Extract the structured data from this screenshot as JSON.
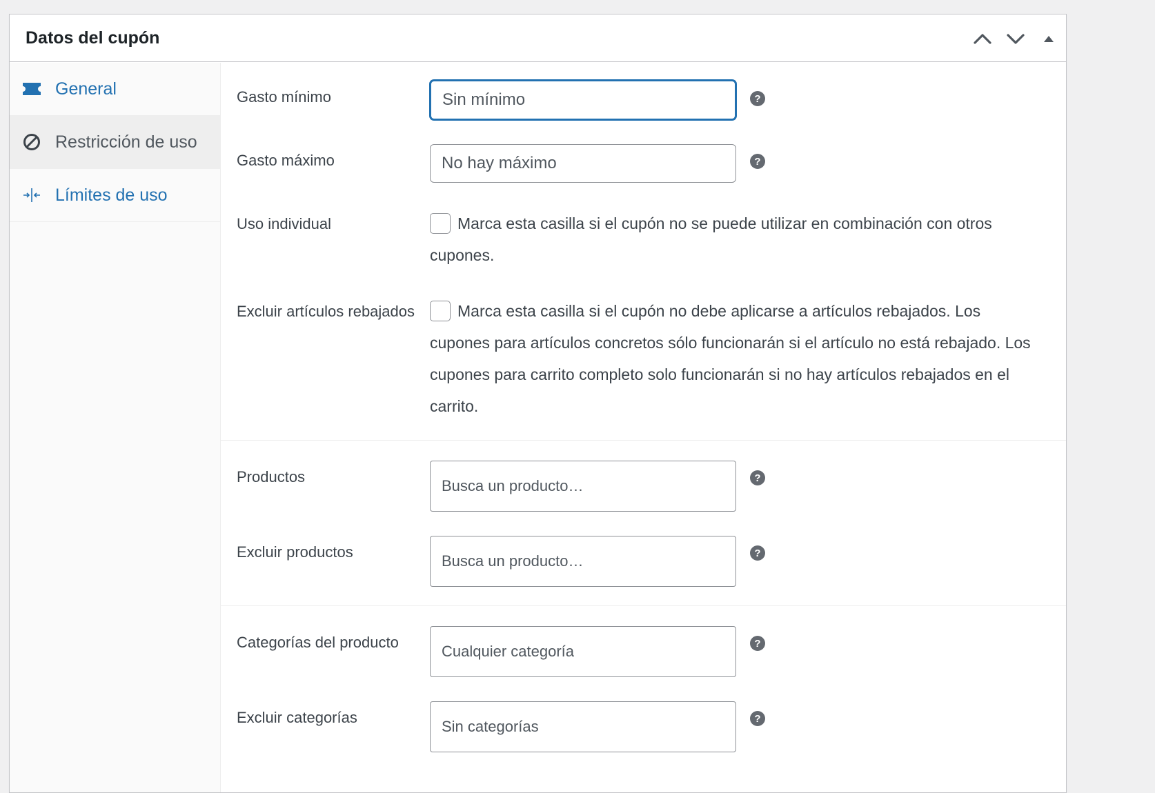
{
  "panel": {
    "title": "Datos del cupón"
  },
  "header_controls": {
    "move_up_icon": "chevron-up-icon",
    "move_down_icon": "chevron-down-icon",
    "toggle_icon": "triangle-up-icon"
  },
  "tabs": [
    {
      "label": "General",
      "icon": "ticket-icon",
      "active": false
    },
    {
      "label": "Restricción de uso",
      "icon": "no-entry-icon",
      "active": true
    },
    {
      "label": "Límites de uso",
      "icon": "arrows-in-icon",
      "active": false
    }
  ],
  "fields": {
    "min_spend": {
      "label": "Gasto mínimo",
      "placeholder": "Sin mínimo",
      "value": ""
    },
    "max_spend": {
      "label": "Gasto máximo",
      "placeholder": "No hay máximo",
      "value": ""
    },
    "individual_use": {
      "label": "Uso individual",
      "description": "Marca esta casilla si el cupón no se puede utilizar en combinación con otros cupones.",
      "checked": false
    },
    "exclude_sale": {
      "label": "Excluir artículos rebajados",
      "description": "Marca esta casilla si el cupón no debe aplicarse a artículos rebajados. Los cupones para artículos concretos sólo funcionarán si el artículo no está rebajado. Los cupones para carrito completo solo funcionarán si no hay artículos rebajados en el carrito.",
      "checked": false
    },
    "products": {
      "label": "Productos",
      "placeholder": "Busca un producto…"
    },
    "exclude_products": {
      "label": "Excluir productos",
      "placeholder": "Busca un producto…"
    },
    "product_categories": {
      "label": "Categorías del producto",
      "placeholder": "Cualquier categoría"
    },
    "exclude_categories": {
      "label": "Excluir categorías",
      "placeholder": "Sin categorías"
    }
  },
  "colors": {
    "accent": "#2271b1",
    "help_icon": "#646970",
    "border": "#8c8f94"
  }
}
